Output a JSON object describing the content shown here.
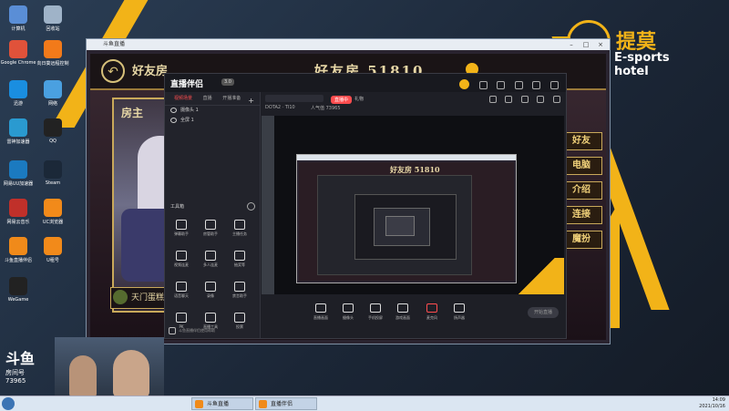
{
  "desktop": {
    "icons": [
      {
        "label": "计算机",
        "color": "#5a8ed6"
      },
      {
        "label": "回收站",
        "color": "#9fb3c8"
      },
      {
        "label": "Google Chrome",
        "color": "#e0523a"
      },
      {
        "label": "向日葵远程控制",
        "color": "#f27a1a"
      },
      {
        "label": "迅游",
        "color": "#1a8ee0"
      },
      {
        "label": "网络",
        "color": "#4aa0e0"
      },
      {
        "label": "雷神加速器",
        "color": "#2a9ad0"
      },
      {
        "label": "QQ",
        "color": "#222222"
      },
      {
        "label": "网易UU加速器",
        "color": "#1b7ac0"
      },
      {
        "label": "Steam",
        "color": "#1b2838"
      },
      {
        "label": "网易云音乐",
        "color": "#c0302a"
      },
      {
        "label": "UC浏览器",
        "color": "#f28a1a"
      },
      {
        "label": "斗鱼直播伴侣",
        "color": "#f08a1a"
      },
      {
        "label": "U租号",
        "color": "#f28a1a"
      },
      {
        "label": "WeGame",
        "color": "#222222"
      }
    ]
  },
  "brand": {
    "cn": "提莫",
    "en": "E-sports hotel",
    "accent": "#f2b318"
  },
  "outer_window": {
    "title": "斗鱼直播"
  },
  "game": {
    "title": "好友房",
    "room_label": "好友房",
    "room_number": "51810",
    "owner": "房主",
    "player": "天门蛋糕",
    "side_menu": [
      "好友",
      "电脑",
      "介绍",
      "连接",
      "魔扮"
    ]
  },
  "live_app": {
    "logo": "直播伴侣",
    "version": "3.0",
    "tabs": [
      "视频场景",
      "直播",
      "开播准备"
    ],
    "sources": [
      {
        "label": "摄像头 1"
      },
      {
        "label": "全屏 1"
      }
    ],
    "tools_header": "工具箱",
    "tools": [
      "弹幕助手",
      "房管助手",
      "主播任务",
      "视频连麦",
      "多人连麦",
      "抽奖等",
      "语音聊天",
      "录像",
      "禁言助手",
      "PK",
      "直播工具",
      "投票"
    ],
    "footer": "斗鱼直播伴侣使用帮助",
    "game_name": "DOTA2 · TI10",
    "popularity": "人气值 73965",
    "tag_live": "直播中",
    "tag_gift": "礼物",
    "preview_title": "好友房 51810",
    "bottom_buttons": [
      "直播画面",
      "摄像头",
      "手机投屏",
      "游戏画面",
      "麦克风",
      "扬声器"
    ],
    "start_button": "开始直播"
  },
  "overlay": {
    "platform": "斗鱼",
    "room_label": "房间号",
    "room_number": "73965"
  },
  "taskbar": {
    "items": [
      {
        "label": "斗鱼直播",
        "color": "#f08a1a"
      },
      {
        "label": "直播伴侣",
        "color": "#f08a1a"
      }
    ],
    "time": "14:09",
    "date": "2021/10/16"
  }
}
